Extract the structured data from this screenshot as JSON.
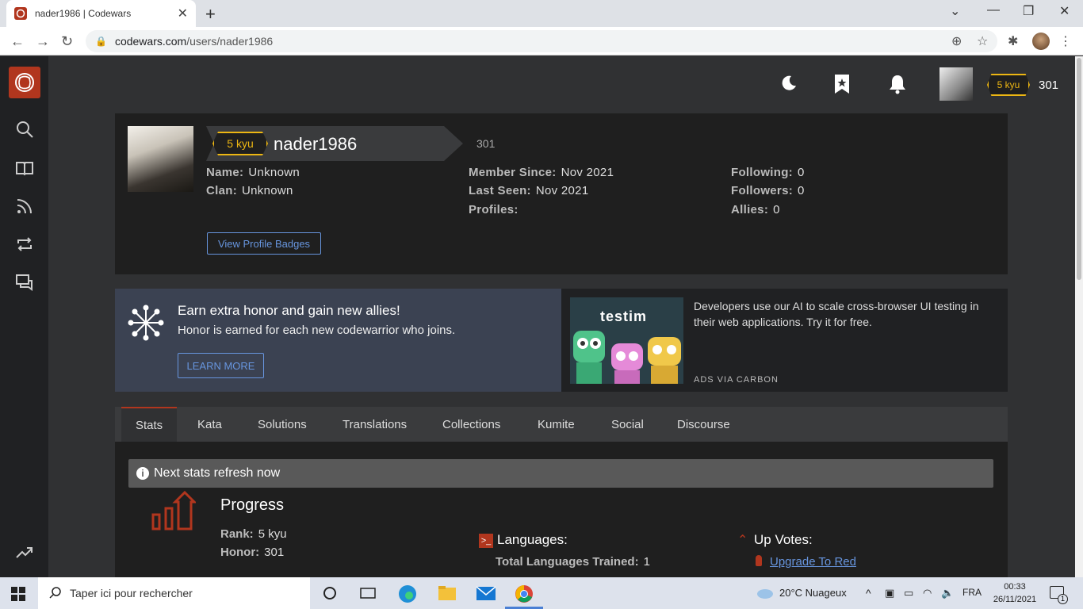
{
  "browser": {
    "tab_title": "nader1986 | Codewars",
    "url_host": "codewars.com",
    "url_path": "/users/nader1986"
  },
  "header": {
    "rank": "5 kyu",
    "honor": "301"
  },
  "profile": {
    "rank": "5 kyu",
    "username": "nader1986",
    "honor": "301",
    "name_label": "Name:",
    "name_value": "Unknown",
    "clan_label": "Clan:",
    "clan_value": "Unknown",
    "member_since_label": "Member Since:",
    "member_since_value": "Nov 2021",
    "last_seen_label": "Last Seen:",
    "last_seen_value": "Nov 2021",
    "profiles_label": "Profiles:",
    "following_label": "Following:",
    "following_value": "0",
    "followers_label": "Followers:",
    "followers_value": "0",
    "allies_label": "Allies:",
    "allies_value": "0",
    "badges_button": "View Profile Badges"
  },
  "promo": {
    "title": "Earn extra honor and gain new allies!",
    "text": "Honor is earned for each new codewarrior who joins.",
    "button": "LEARN MORE"
  },
  "ad": {
    "brand": "testim",
    "text": "Developers use our AI to scale cross-browser UI testing in their web applications. Try it for free.",
    "via": "ADS VIA CARBON"
  },
  "tabs": [
    "Stats",
    "Kata",
    "Solutions",
    "Translations",
    "Collections",
    "Kumite",
    "Social",
    "Discourse"
  ],
  "stats": {
    "refresh": "Next stats refresh now",
    "progress_title": "Progress",
    "rank_label": "Rank:",
    "rank_value": "5 kyu",
    "honor_label": "Honor:",
    "honor_value": "301",
    "languages_title": "Languages:",
    "languages_trained_label": "Total Languages Trained:",
    "languages_trained_value": "1",
    "upvotes_title": "Up Votes:",
    "upgrade_link": "Upgrade To Red"
  },
  "taskbar": {
    "search_placeholder": "Taper ici pour rechercher",
    "weather": "20°C  Nuageux",
    "lang": "FRA",
    "time": "00:33",
    "date": "26/11/2021",
    "notifications": "1"
  },
  "colors": {
    "accent": "#b1361e",
    "rank_yellow": "#ecb613",
    "link_blue": "#6795de"
  }
}
